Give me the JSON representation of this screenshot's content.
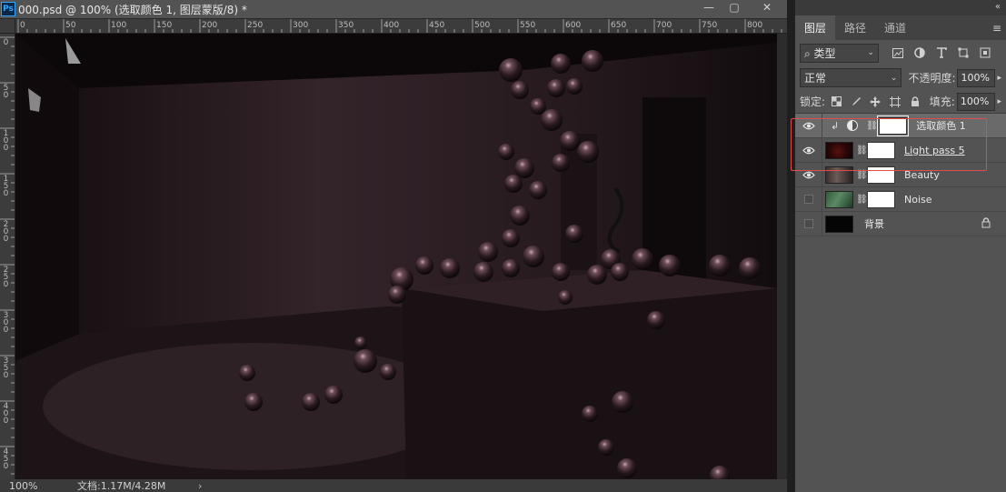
{
  "document": {
    "title": "000.psd @ 100% (选取颜色 1, 图层蒙版/8) *",
    "app_badge": "Ps"
  },
  "window_controls": {
    "minimize": "—",
    "restore": "▢",
    "close": "✕",
    "extra": "⬚"
  },
  "ruler_h": [
    "0",
    "50",
    "100",
    "150",
    "200",
    "250",
    "300",
    "350",
    "400",
    "450",
    "500",
    "550",
    "600",
    "650",
    "700",
    "750",
    "800"
  ],
  "ruler_v": [
    "0",
    "50",
    "100",
    "150",
    "200",
    "250",
    "300",
    "350",
    "400",
    "450"
  ],
  "statusbar": {
    "zoom": "100%",
    "doc_info": "文档:1.17M/4.28M",
    "arrow": "›"
  },
  "panel": {
    "collapse": "«",
    "tabs": [
      {
        "label": "图层",
        "active": true
      },
      {
        "label": "路径",
        "active": false
      },
      {
        "label": "通道",
        "active": false
      }
    ],
    "menu_icon": "≡",
    "filter": {
      "label": "⌕ 类型",
      "caret": "⌄"
    },
    "filter_icons": [
      "image-filter-icon",
      "adjustment-filter-icon",
      "type-filter-icon",
      "shape-filter-icon",
      "smart-object-filter-icon"
    ],
    "blend_mode": "正常",
    "opacity_label": "不透明度:",
    "opacity_value": "100%",
    "lock_label": "锁定:",
    "fill_label": "填充:",
    "fill_value": "100%"
  },
  "layers": [
    {
      "name": "选取颜色 1",
      "visible": true,
      "type": "adjustment",
      "selected": true
    },
    {
      "name": "Light pass 5",
      "visible": true,
      "type": "image",
      "underlined": true
    },
    {
      "name": "Beauty",
      "visible": true,
      "type": "image"
    },
    {
      "name": "Noise",
      "visible": false,
      "type": "image"
    },
    {
      "name": "背景",
      "visible": false,
      "type": "background",
      "locked": true
    }
  ],
  "colors": {
    "highlight": "#e14b4b",
    "panel_bg": "#535353",
    "selected_layer": "#6a6a6a"
  }
}
